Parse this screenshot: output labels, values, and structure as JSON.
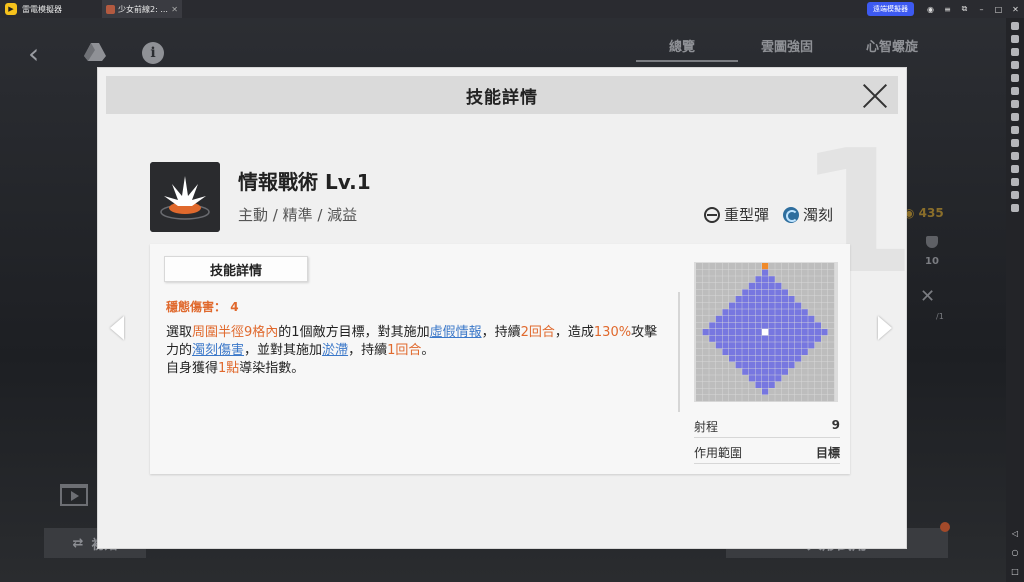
{
  "titlebar": {
    "app_name": "雷電模擬器",
    "tab_label": "少女前線2: ...",
    "tab_close": "✕",
    "badge": "遠端模擬器"
  },
  "background": {
    "tabs": [
      "總覽",
      "雲圖強固",
      "心智螺旋"
    ],
    "coins": "435",
    "stat_value": "10",
    "stat_fraction": "/1",
    "start_button": "初始",
    "trial_button": "人形試用"
  },
  "modal": {
    "title": "技能詳情",
    "big_number": "1",
    "skill_name": "情報戰術 Lv.1",
    "skill_tags": "主動 / 精準 / 減益",
    "ammo_type": "重型彈",
    "element_type": "濁刻",
    "detail_tab": "技能詳情",
    "stability_label": "穩態傷害：",
    "stability_value": "4",
    "desc": {
      "p1": "選取",
      "p2": "周圍半徑9格內",
      "p3": "的1個敵方目標，對其施加",
      "p4": "虛假情報",
      "p5": "，持續",
      "p6": "2回合",
      "p7": "，造成",
      "p8": "130%",
      "p9": "攻擊力的",
      "p10": "濁刻傷害",
      "p11": "，並對其施加",
      "p12": "淤滯",
      "p13": "，持續",
      "p14": "1回合",
      "p15": "。",
      "p16": "自身獲得",
      "p17": "1點",
      "p18": "導染指數。"
    },
    "range_label": "射程",
    "range_value": "9",
    "area_label": "作用範圍",
    "area_value": "目標",
    "grid": {
      "size": 21,
      "radius": 9,
      "target_color": "#7777e0",
      "empty_color": "#bdbdbd",
      "center_color": "#ffffff",
      "marker_color": "#f08a2a"
    }
  }
}
